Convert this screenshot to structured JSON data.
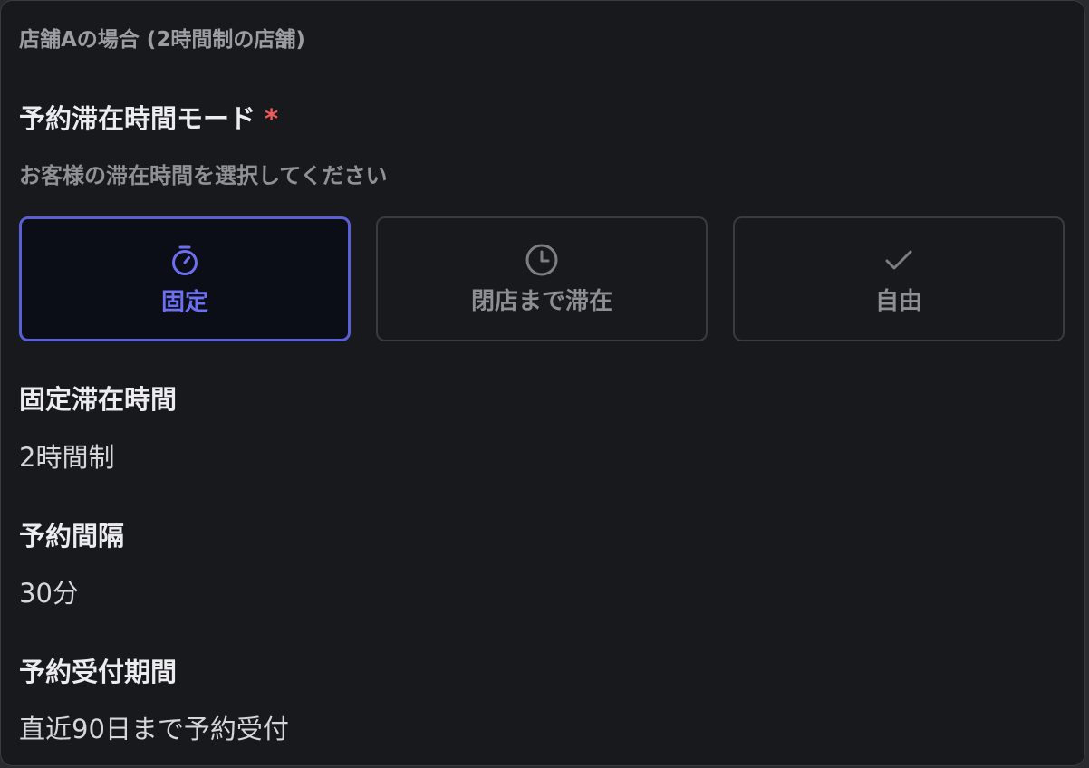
{
  "header": {
    "title": "店舗Aの場合 (2時間制の店舗)"
  },
  "stay_mode": {
    "label": "予約滞在時間モード",
    "required_mark": "*",
    "description": "お客様の滞在時間を選択してください",
    "options": [
      {
        "label": "固定",
        "icon": "stopwatch-icon",
        "selected": true
      },
      {
        "label": "閉店まで滞在",
        "icon": "clock-icon",
        "selected": false
      },
      {
        "label": "自由",
        "icon": "check-icon",
        "selected": false
      }
    ]
  },
  "fixed_stay": {
    "label": "固定滞在時間",
    "value": "2時間制"
  },
  "interval": {
    "label": "予約間隔",
    "value": "30分"
  },
  "reception_period": {
    "label": "予約受付期間",
    "value": "直近90日まで予約受付"
  },
  "colors": {
    "accent": "#5b5fd6",
    "required": "#f05a5a",
    "background": "#18191d"
  }
}
